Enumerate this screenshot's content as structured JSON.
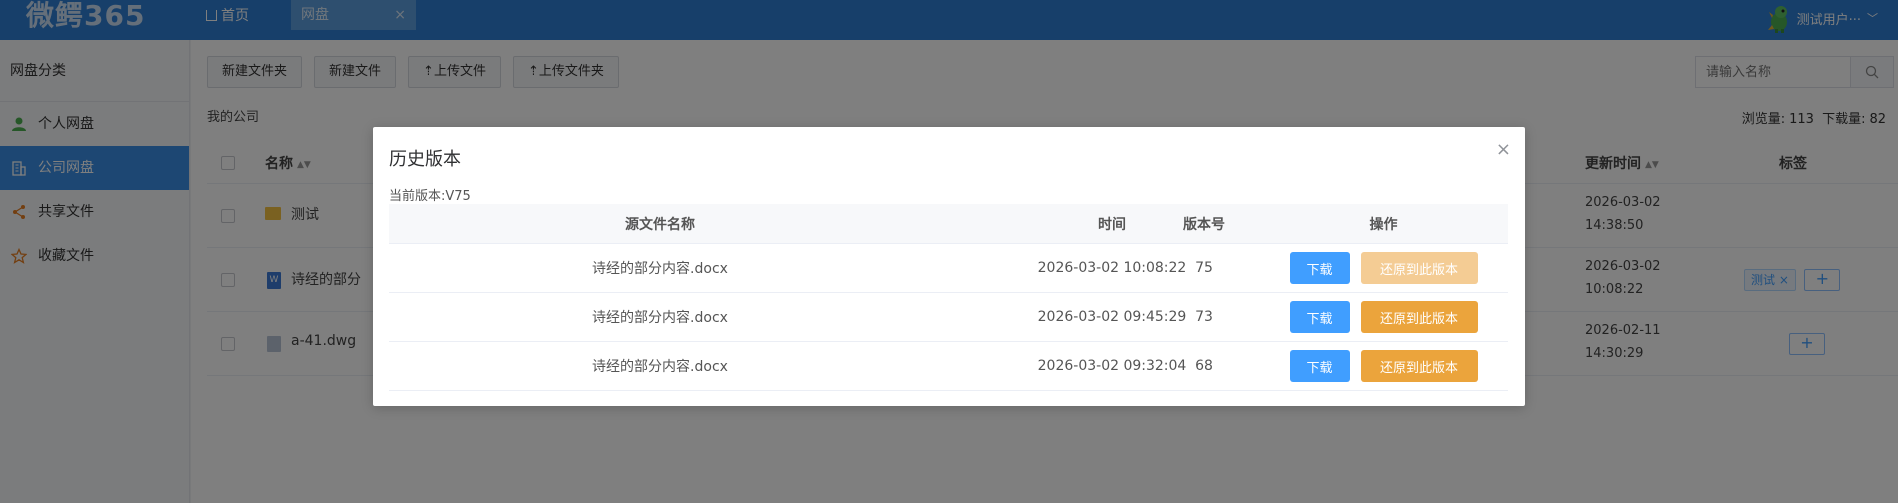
{
  "app": {
    "logo": "微鳄365",
    "nav_home": "首页",
    "active_tab": "网盘",
    "tab_close": "×",
    "user_name": "测试用户···"
  },
  "sidebar": {
    "title": "网盘分类",
    "items": [
      {
        "label": "个人网盘",
        "icon": "person-icon"
      },
      {
        "label": "公司网盘",
        "icon": "building-icon"
      },
      {
        "label": "共享文件",
        "icon": "share-icon"
      },
      {
        "label": "收藏文件",
        "icon": "star-icon"
      }
    ]
  },
  "toolbar": {
    "new_folder": "新建文件夹",
    "new_file": "新建文件",
    "upload_file": "上传文件",
    "upload_folder": "上传文件夹"
  },
  "search": {
    "placeholder": "请输入名称"
  },
  "breadcrumb": "我的公司",
  "stats": {
    "views_label": "浏览量:",
    "views": "113",
    "downloads_label": "下载量:",
    "downloads": "82"
  },
  "file_table": {
    "headers": {
      "name": "名称",
      "updated": "更新时间",
      "tags": "标签"
    },
    "rows": [
      {
        "name": "测试",
        "date": "2026-03-02",
        "time": "14:38:50",
        "tag": ""
      },
      {
        "name": "诗经的部分",
        "date": "2026-03-02",
        "time": "10:08:22",
        "tag": "测试"
      },
      {
        "name": "a-41.dwg",
        "date": "2026-02-11",
        "time": "14:30:29",
        "tag": ""
      }
    ],
    "tag_remove": "×",
    "tag_add": "+"
  },
  "dialog": {
    "title": "历史版本",
    "close": "×",
    "current_version_label": "当前版本:",
    "current_version": "V75",
    "headers": {
      "name": "源文件名称",
      "time": "时间",
      "version": "版本号",
      "action": "操作"
    },
    "rows": [
      {
        "name": "诗经的部分内容.docx",
        "time": "2026-03-02 10:08:22",
        "version": "75",
        "download": "下载",
        "restore": "还原到此版本"
      },
      {
        "name": "诗经的部分内容.docx",
        "time": "2026-03-02 09:45:29",
        "version": "73",
        "download": "下载",
        "restore": "还原到此版本"
      },
      {
        "name": "诗经的部分内容.docx",
        "time": "2026-03-02 09:32:04",
        "version": "68",
        "download": "下载",
        "restore": "还原到此版本"
      }
    ]
  },
  "colors": {
    "primary": "#2f7fd4",
    "download_btn": "#409eff",
    "restore_btn": "#eba43c",
    "restore_disabled": "#f4cc94"
  }
}
